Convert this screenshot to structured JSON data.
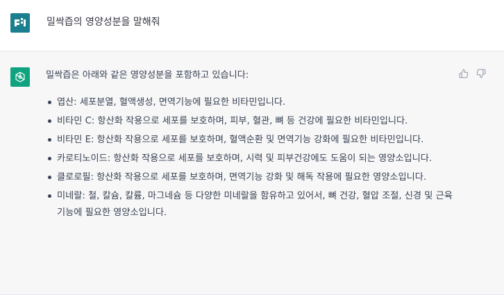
{
  "user_message": {
    "text": "밀싹즙의 영양성분을 말해줘",
    "avatar_icon": "user-avatar-icon"
  },
  "assistant_message": {
    "avatar_icon": "openai-logo-icon",
    "intro": "밀싹즙은 아래와 같은 영양성분을 포함하고 있습니다:",
    "items": [
      "엽산: 세포분열, 혈액생성, 면역기능에 필요한 비타민입니다.",
      "비타민 C: 항산화 작용으로 세포를 보호하며, 피부, 혈관, 뼈 등 건강에 필요한 비타민입니다.",
      "비타민 E: 항산화 작용으로 세포를 보호하며, 혈액순환 및 면역기능 강화에 필요한 비타민입니다.",
      "카로티노이드: 항산화 작용으로 세포를 보호하며, 시력 및 피부건강에도 도움이 되는 영양소입니다.",
      "클로로필: 항산화 작용으로 세포를 보호하며, 면역기능 강화 및 해독 작용에 필요한 영양소입니다.",
      "미네랄: 철, 칼슘, 칼륨, 마그네슘 등 다양한 미네랄을 함유하고 있어서, 뼈 건강, 혈압 조절, 신경 및 근육 기능에 필요한 영양소입니다."
    ],
    "feedback": {
      "thumbs_up_icon": "thumbs-up-icon",
      "thumbs_down_icon": "thumbs-down-icon"
    }
  },
  "colors": {
    "user_bg": "#ffffff",
    "assistant_bg": "#f7f7f8",
    "brand_green": "#10a37f",
    "user_avatar": "#1a7f8e",
    "text": "#374151"
  }
}
